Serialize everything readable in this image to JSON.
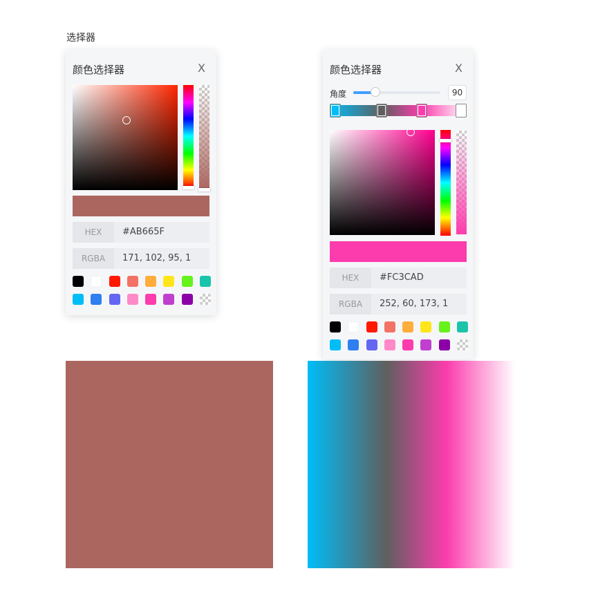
{
  "page_label": "选择器",
  "left_picker": {
    "title": "颜色选择器",
    "close_label": "X",
    "hue_color": "#ff2600",
    "color": "#AB665F",
    "hex_label": "HEX",
    "hex_value": "#AB665F",
    "rgba_label": "RGBA",
    "rgba_value": "171, 102, 95, 1"
  },
  "right_picker": {
    "title": "颜色选择器",
    "close_label": "X",
    "angle_label": "角度",
    "angle_value": "90",
    "angle_max": 360,
    "gradient_stops": [
      {
        "color": "#00bdf7",
        "position": 0
      },
      {
        "color": "#5f5f5f",
        "position": 0.38
      },
      {
        "color": "#fc3cad",
        "position": 0.67
      },
      {
        "color": "#ffffff",
        "position": 1
      }
    ],
    "hue_color": "#ff0090",
    "color": "#FC3CAD",
    "hex_label": "HEX",
    "hex_value": "#FC3CAD",
    "rgba_label": "RGBA",
    "rgba_value": "252, 60, 173, 1"
  },
  "swatches": [
    [
      "#000000",
      "#ffffff",
      "#ff1a00",
      "#f27366",
      "#ffad3b",
      "#ffe61a",
      "#66f21a",
      "#1ac4aa"
    ],
    [
      "#00bdf7",
      "#2f7ff0",
      "#6366f1",
      "#ff8ac8",
      "#fc3cad",
      "#c03fcf",
      "#8c00a8",
      "transparent"
    ]
  ],
  "outputs": {
    "left_color": "#AB665F",
    "right_gradient": "linear-gradient(90deg, #00bdf7 0%, #5f5f5f 38%, #fc3cad 67%, #ffffff 100%)"
  }
}
